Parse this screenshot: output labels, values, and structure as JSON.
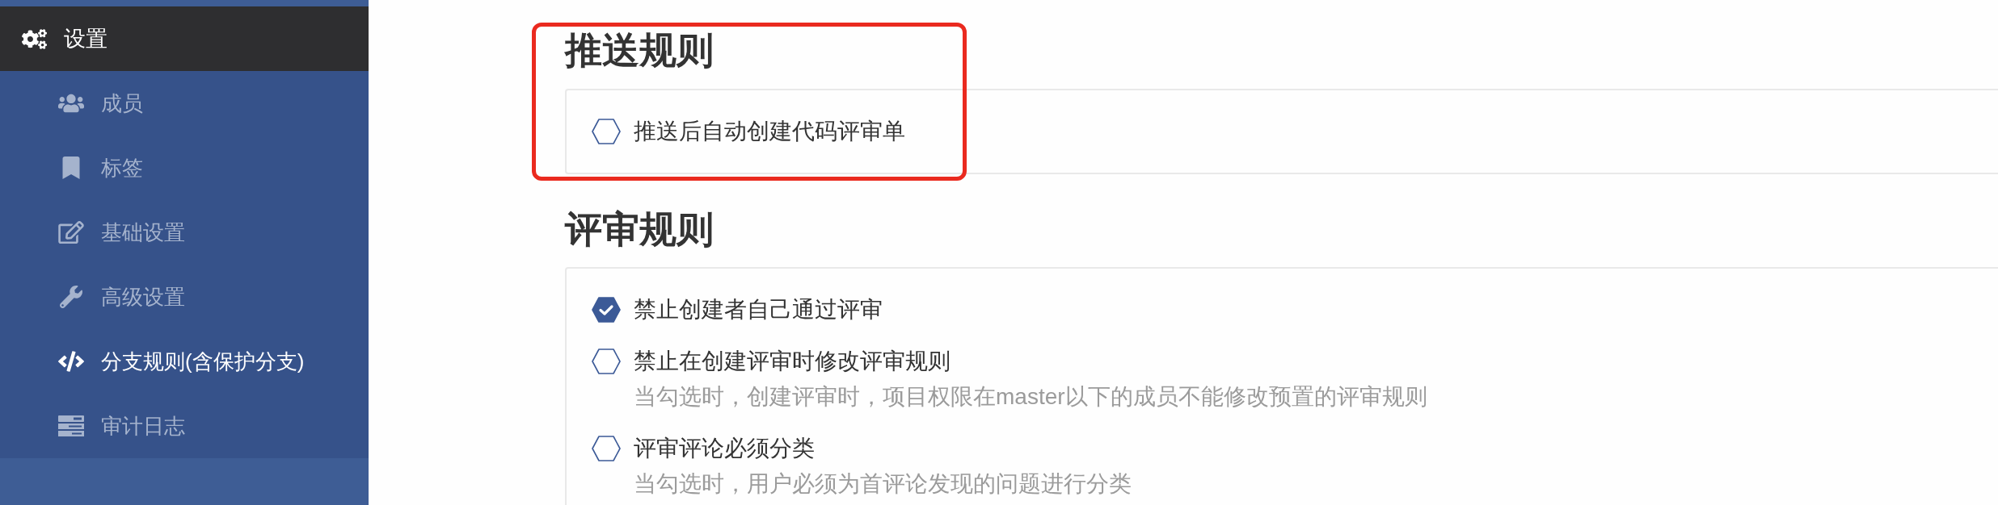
{
  "sidebar": {
    "header": {
      "label": "设置"
    },
    "items": [
      {
        "label": "成员",
        "selected": false
      },
      {
        "label": "标签",
        "selected": false
      },
      {
        "label": "基础设置",
        "selected": false
      },
      {
        "label": "高级设置",
        "selected": false
      },
      {
        "label": "分支规则(含保护分支)",
        "selected": true
      },
      {
        "label": "审计日志",
        "selected": false
      }
    ]
  },
  "sections": [
    {
      "title": "推送规则",
      "highlighted": true,
      "options": [
        {
          "label": "推送后自动创建代码评审单",
          "checked": false
        }
      ]
    },
    {
      "title": "评审规则",
      "options": [
        {
          "label": "禁止创建者自己通过评审",
          "checked": true
        },
        {
          "label": "禁止在创建评审时修改评审规则",
          "checked": false,
          "description": "当勾选时，创建评审时，项目权限在master以下的成员不能修改预置的评审规则"
        },
        {
          "label": "评审评论必须分类",
          "checked": false,
          "description": "当勾选时，用户必须为首评论发现的问题进行分类"
        }
      ]
    }
  ]
}
